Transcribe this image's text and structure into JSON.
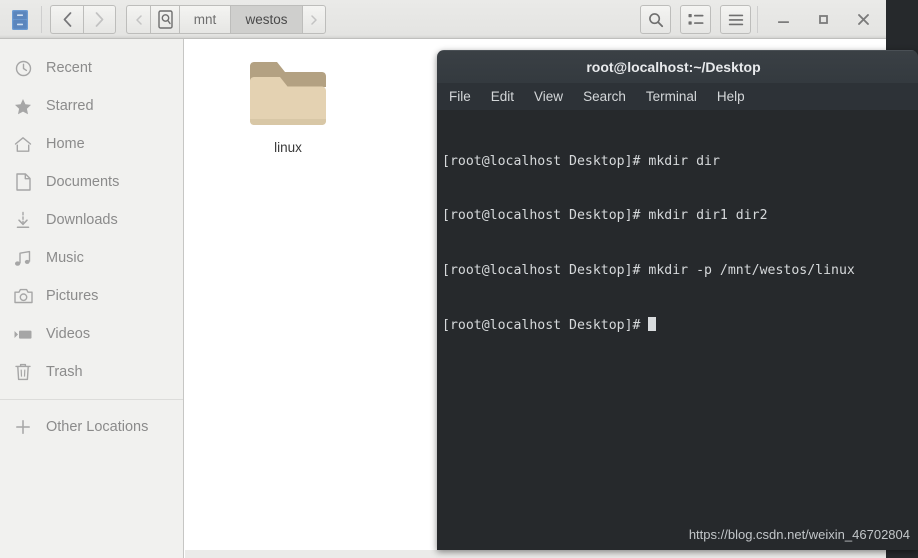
{
  "file_manager": {
    "app_icon": "file-cabinet-icon",
    "nav": {
      "back_icon": "chevron-left-icon",
      "forward_icon": "chevron-right-icon"
    },
    "breadcrumb": {
      "prev_icon": "chevron-left-small-icon",
      "next_icon": "chevron-right-small-icon",
      "drive_icon": "hard-drive-icon",
      "items": [
        {
          "label": "mnt",
          "selected": false
        },
        {
          "label": "westos",
          "selected": true
        }
      ]
    },
    "toolbar": {
      "search_icon": "search-icon",
      "view_list_icon": "list-view-icon",
      "menu_icon": "hamburger-menu-icon"
    },
    "window_controls": {
      "minimize": "minimize-icon",
      "maximize": "maximize-icon",
      "close": "close-icon"
    },
    "sidebar": {
      "items": [
        {
          "label": "Recent",
          "icon": "clock-icon"
        },
        {
          "label": "Starred",
          "icon": "star-icon"
        },
        {
          "label": "Home",
          "icon": "home-icon"
        },
        {
          "label": "Documents",
          "icon": "document-icon"
        },
        {
          "label": "Downloads",
          "icon": "download-icon"
        },
        {
          "label": "Music",
          "icon": "music-note-icon"
        },
        {
          "label": "Pictures",
          "icon": "camera-icon"
        },
        {
          "label": "Videos",
          "icon": "video-camera-icon"
        },
        {
          "label": "Trash",
          "icon": "trash-icon"
        }
      ],
      "other_locations": {
        "label": "Other Locations",
        "icon": "plus-icon"
      }
    },
    "content": {
      "files": [
        {
          "name": "linux",
          "icon": "folder-icon"
        }
      ]
    }
  },
  "terminal": {
    "title": "root@localhost:~/Desktop",
    "menu": [
      "File",
      "Edit",
      "View",
      "Search",
      "Terminal",
      "Help"
    ],
    "lines": [
      "[root@localhost Desktop]# mkdir dir",
      "[root@localhost Desktop]# mkdir dir1 dir2",
      "[root@localhost Desktop]# mkdir -p /mnt/westos/linux"
    ],
    "prompt": "[root@localhost Desktop]# ",
    "watermark": "https://blog.csdn.net/weixin_46702804"
  },
  "colors": {
    "terminal_bg": "#26292c",
    "terminal_titlebar": "#343a3f",
    "terminal_menubar": "#2d3237",
    "sidebar_bg": "#f1f1ef",
    "header_bg": "#e8e8e6",
    "folder_front": "#e4d2b2",
    "folder_back": "#b8a684"
  }
}
